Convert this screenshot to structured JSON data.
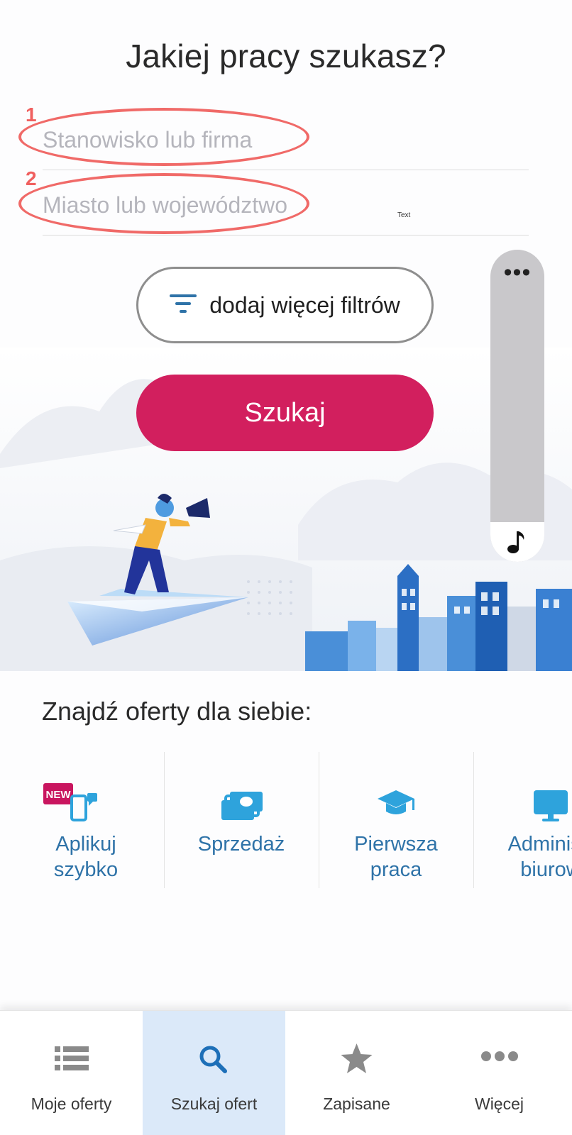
{
  "page": {
    "title": "Jakiej pracy szukasz?"
  },
  "search": {
    "position_placeholder": "Stanowisko lub firma",
    "location_placeholder": "Miasto lub województwo",
    "filters_label": "dodaj więcej filtrów",
    "submit_label": "Szukaj"
  },
  "annotations": {
    "marker_1": "1",
    "marker_2": "2",
    "tiny_text": "Text"
  },
  "floating_panel": {
    "menu_glyph": "•••",
    "music_icon": "music-note-icon"
  },
  "categories": {
    "heading": "Znajdź oferty dla siebie:",
    "items": [
      {
        "label": "Aplikuj szybko",
        "icon": "quick-apply-icon",
        "badge": "NEW"
      },
      {
        "label": "Sprzedaż",
        "icon": "money-icon"
      },
      {
        "label": "Pierwsza praca",
        "icon": "graduation-cap-icon"
      },
      {
        "label": "Administr biurow",
        "icon": "monitor-icon"
      }
    ]
  },
  "bottom_nav": {
    "items": [
      {
        "label": "Moje oferty",
        "icon": "list-icon",
        "active": false
      },
      {
        "label": "Szukaj ofert",
        "icon": "search-icon",
        "active": true
      },
      {
        "label": "Zapisane",
        "icon": "star-icon",
        "active": false
      },
      {
        "label": "Więcej",
        "icon": "more-icon",
        "active": false
      }
    ]
  },
  "colors": {
    "primary": "#d21f5e",
    "link_blue": "#2f73a8",
    "annotation_red": "#f0605f",
    "nav_active_bg": "#dbe9f9"
  }
}
